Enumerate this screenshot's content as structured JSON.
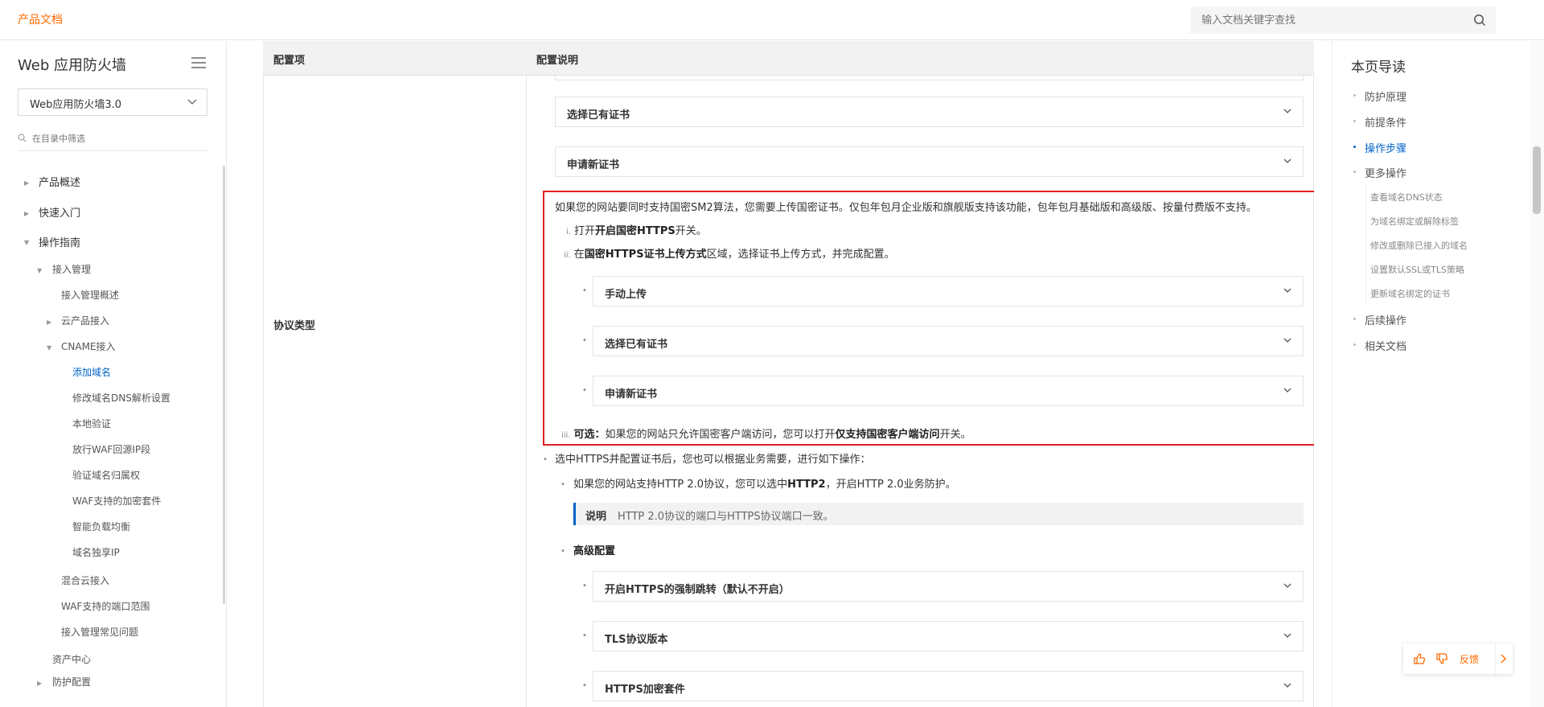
{
  "header": {
    "brand": "产品文档",
    "search_placeholder": "输入文档关键字查找"
  },
  "sidebar": {
    "title": "Web 应用防火墙",
    "version": "Web应用防火墙3.0",
    "filter_placeholder": "在目录中筛选",
    "items": [
      {
        "label": "产品概述"
      },
      {
        "label": "快速入门"
      },
      {
        "label": "操作指南"
      },
      {
        "label": "接入管理"
      },
      {
        "label": "接入管理概述"
      },
      {
        "label": "云产品接入"
      },
      {
        "label": "CNAME接入"
      },
      {
        "label": "添加域名"
      },
      {
        "label": "修改域名DNS解析设置"
      },
      {
        "label": "本地验证"
      },
      {
        "label": "放行WAF回源IP段"
      },
      {
        "label": "验证域名归属权"
      },
      {
        "label": "WAF支持的加密套件"
      },
      {
        "label": "智能负载均衡"
      },
      {
        "label": "域名独享IP"
      },
      {
        "label": "混合云接入"
      },
      {
        "label": "WAF支持的端口范围"
      },
      {
        "label": "接入管理常见问题"
      },
      {
        "label": "资产中心"
      },
      {
        "label": "防护配置"
      }
    ]
  },
  "table": {
    "col1": "配置项",
    "col2": "配置说明",
    "row_label": "协议类型"
  },
  "content": {
    "collapse_select_existing": "选择已有证书",
    "collapse_apply_new": "申请新证书",
    "sm2_intro": "如果您的网站要同时支持国密SM2算法，您需要上传国密证书。仅包年包月企业版和旗舰版支持该功能，包年包月基础版和高级版、按量付费版不支持。",
    "step_i_num": "i.",
    "step_i_pre": "打开",
    "step_i_bold": "开启国密HTTPS",
    "step_i_post": "开关。",
    "step_ii_num": "ii.",
    "step_ii_pre": "在",
    "step_ii_bold": "国密HTTPS证书上传方式",
    "step_ii_post": "区域，选择证书上传方式，并完成配置。",
    "collapse_manual_upload": "手动上传",
    "collapse_select_existing_2": "选择已有证书",
    "collapse_apply_new_2": "申请新证书",
    "step_iii_num": "iii.",
    "step_iii_bold1": "可选：",
    "step_iii_mid": "如果您的网站只允许国密客户端访问，您可以打开",
    "step_iii_bold2": "仅支持国密客户端访问",
    "step_iii_post": "开关。",
    "https_after": "选中HTTPS并配置证书后，您也可以根据业务需要，进行如下操作：",
    "http2_pre": "如果您的网站支持HTTP 2.0协议，您可以选中",
    "http2_bold": "HTTP2",
    "http2_post": "，开启HTTP 2.0业务防护。",
    "note_title": "说明",
    "note_text": "HTTP 2.0协议的端口与HTTPS协议端口一致。",
    "advanced": "高级配置",
    "collapse_force_redirect": "开启HTTPS的强制跳转（默认不开启）",
    "collapse_tls": "TLS协议版本",
    "collapse_cipher": "HTTPS加密套件"
  },
  "toc": {
    "title": "本页导读",
    "items": [
      {
        "label": "防护原理"
      },
      {
        "label": "前提条件"
      },
      {
        "label": "操作步骤"
      },
      {
        "label": "更多操作"
      },
      {
        "label": "查看域名DNS状态"
      },
      {
        "label": "为域名绑定或解除标签"
      },
      {
        "label": "修改或删除已接入的域名"
      },
      {
        "label": "设置默认SSL或TLS策略"
      },
      {
        "label": "更新域名绑定的证书"
      },
      {
        "label": "后续操作"
      },
      {
        "label": "相关文档"
      }
    ]
  },
  "feedback": {
    "label": "反馈"
  },
  "colors": {
    "brand": "#ff6a00",
    "link_active": "#0064c8",
    "highlight_box": "#e02020"
  }
}
